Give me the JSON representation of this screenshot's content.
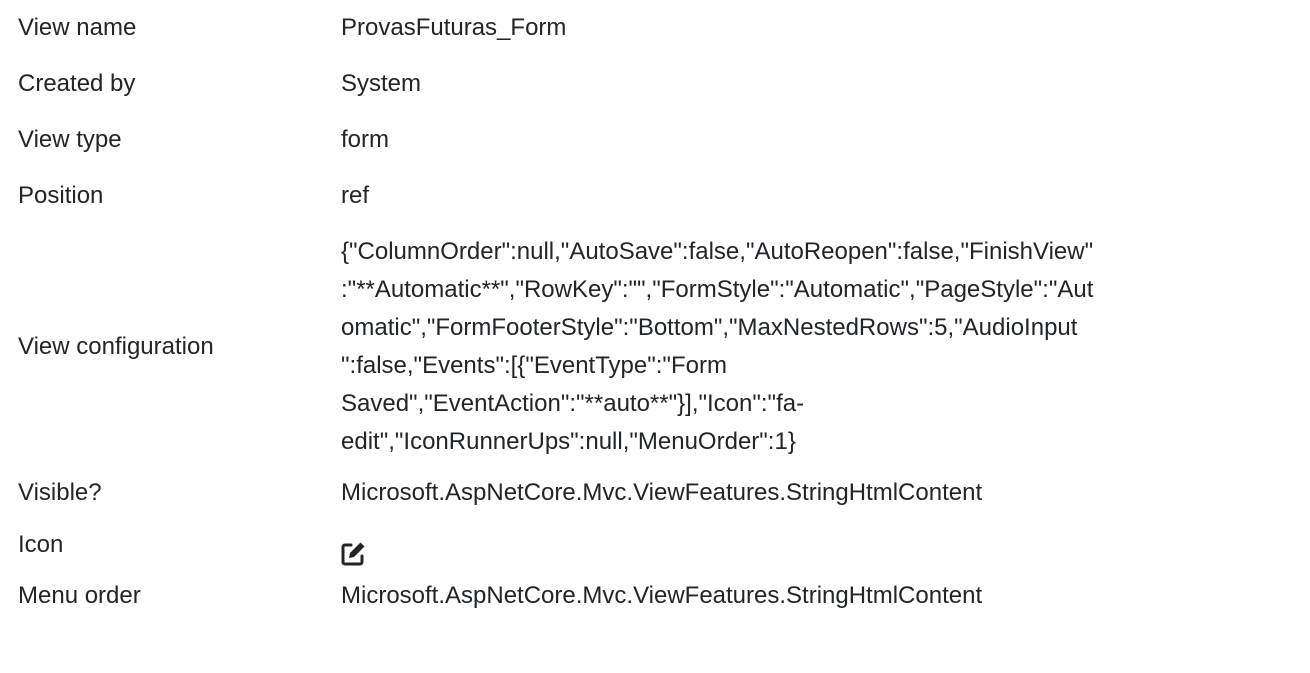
{
  "rows": [
    {
      "label": "View name",
      "value": "ProvasFuturas_Form"
    },
    {
      "label": "Created by",
      "value": "System"
    },
    {
      "label": "View type",
      "value": "form"
    },
    {
      "label": "Position",
      "value": "ref"
    }
  ],
  "config": {
    "label": "View configuration",
    "lines": [
      "{\"ColumnOrder\":null,\"AutoSave\":false,\"AutoReopen\":false,\"FinishView\"",
      ":\"**Automatic**\",\"RowKey\":\"\",\"FormStyle\":\"Automatic\",\"PageStyle\":\"Aut",
      "omatic\",\"FormFooterStyle\":\"Bottom\",\"MaxNestedRows\":5,\"AudioInput",
      "\":false,\"Events\":[{\"EventType\":\"Form",
      "Saved\",\"EventAction\":\"**auto**\"}],\"Icon\":\"fa-",
      "edit\",\"IconRunnerUps\":null,\"MenuOrder\":1}"
    ]
  },
  "visible": {
    "label": "Visible?",
    "value": "Microsoft.AspNetCore.Mvc.ViewFeatures.StringHtmlContent"
  },
  "icon": {
    "label": "Icon",
    "icon_name": "edit-icon"
  },
  "menu_order": {
    "label": "Menu order",
    "value": "Microsoft.AspNetCore.Mvc.ViewFeatures.StringHtmlContent"
  }
}
